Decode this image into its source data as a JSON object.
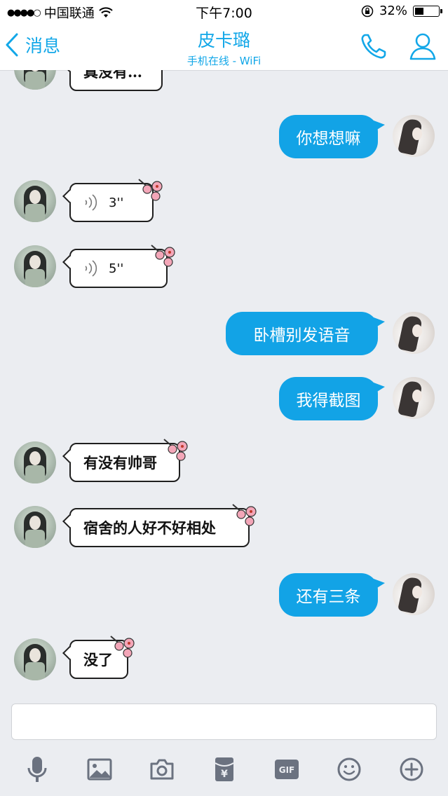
{
  "status": {
    "carrier": "中国联通",
    "time": "下午7:00",
    "battery": "32%"
  },
  "nav": {
    "back_label": "消息",
    "contact_name": "皮卡璐",
    "contact_status": "手机在线 - WiFi"
  },
  "messages": [
    {
      "from": "them",
      "text": "真没有…"
    },
    {
      "from": "me",
      "text": "你想想嘛"
    },
    {
      "from": "them",
      "type": "voice",
      "duration": "3''"
    },
    {
      "from": "them",
      "type": "voice",
      "duration": "5''"
    },
    {
      "from": "me",
      "text": "卧槽别发语音"
    },
    {
      "from": "me",
      "text": "我得截图"
    },
    {
      "from": "them",
      "text": "有没有帅哥"
    },
    {
      "from": "them",
      "text": "宿舍的人好不好相处"
    },
    {
      "from": "me",
      "text": "还有三条"
    },
    {
      "from": "them",
      "text": "没了"
    }
  ],
  "input": {
    "placeholder": ""
  },
  "toolbar": {
    "gif_label": "GIF"
  },
  "colors": {
    "accent": "#12a7e8",
    "bubble_out": "#12a3e6",
    "background": "#ebedf1"
  }
}
